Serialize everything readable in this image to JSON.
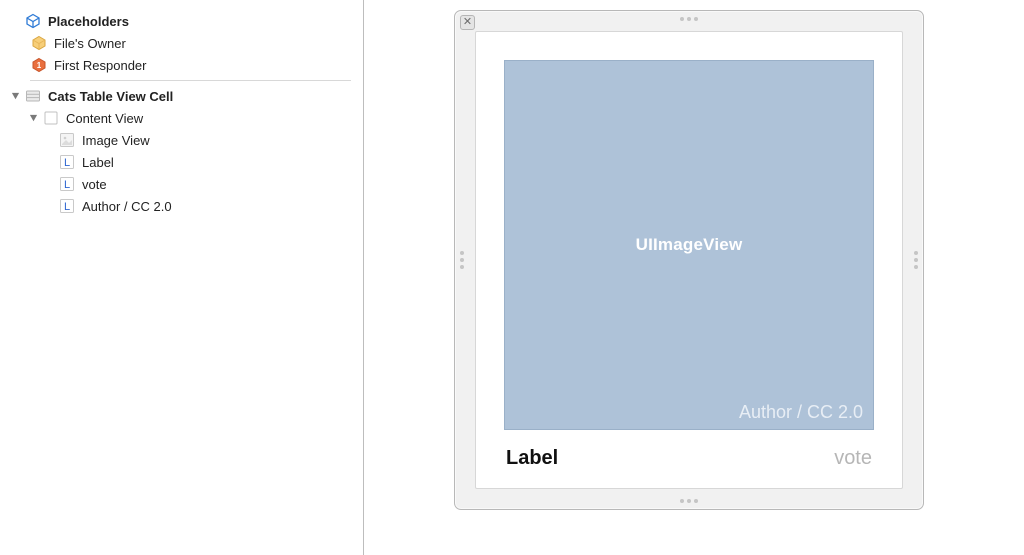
{
  "outline": {
    "placeholders_header": "Placeholders",
    "files_owner": "File's Owner",
    "first_responder": "First Responder",
    "cell_group": "Cats Table View Cell",
    "content_view": "Content View",
    "leaves": {
      "image_view": "Image View",
      "label": "Label",
      "vote": "vote",
      "author": "Author / CC 2.0"
    }
  },
  "canvas": {
    "image_placeholder": "UIImageView",
    "author_text": "Author / CC 2.0",
    "label_text": "Label",
    "vote_text": "vote"
  }
}
